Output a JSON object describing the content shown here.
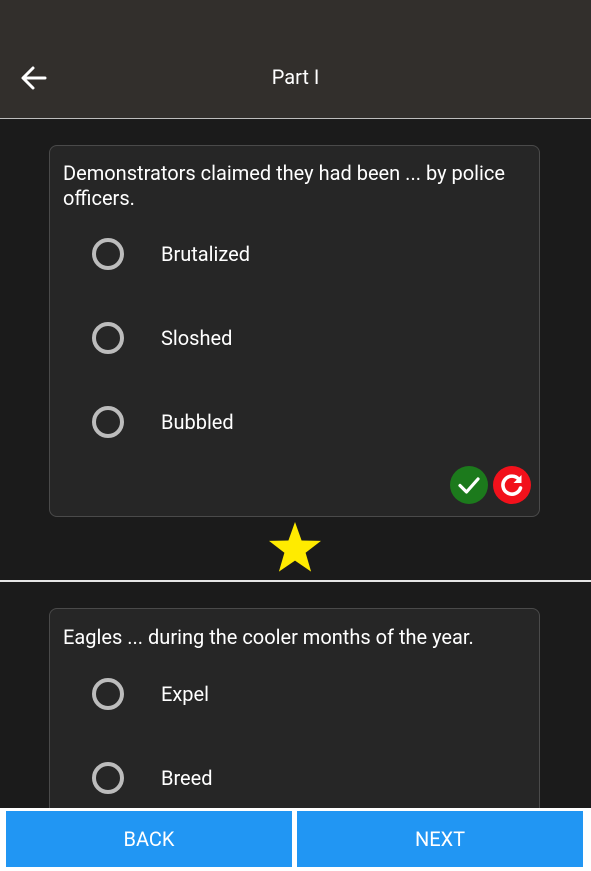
{
  "header": {
    "title": "Part I"
  },
  "questions": [
    {
      "text": "Demonstrators claimed they had been ... by police officers.",
      "options": [
        "Brutalized",
        "Sloshed",
        "Bubbled"
      ]
    },
    {
      "text": "Eagles ... during the cooler months of the year.",
      "options": [
        "Expel",
        "Breed"
      ]
    }
  ],
  "footer": {
    "back_label": "BACK",
    "next_label": "NEXT"
  },
  "icons": {
    "back": "arrow-left-icon",
    "check": "check-icon",
    "reset": "refresh-icon",
    "favorite": "star-icon"
  },
  "colors": {
    "accent": "#2196f3",
    "check": "#1c7a1c",
    "reset": "#f2111b",
    "star": "#ffeb00"
  }
}
